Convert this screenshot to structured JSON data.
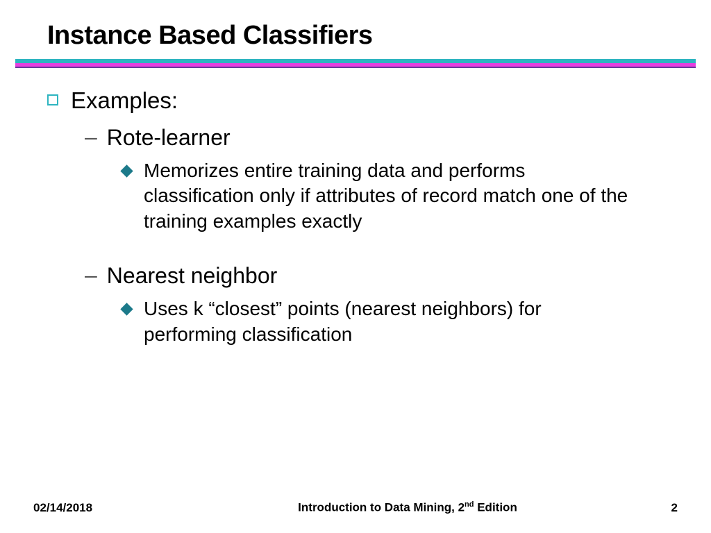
{
  "title": "Instance Based Classifiers",
  "examples_label": "Examples:",
  "items": [
    {
      "name": "Rote-learner",
      "desc": "Memorizes entire training data and performs classification only if attributes of record match one of the training examples exactly"
    },
    {
      "name": "Nearest neighbor",
      "desc": "Uses k “closest” points (nearest neighbors) for performing classification"
    }
  ],
  "footer": {
    "date": "02/14/2018",
    "book_prefix": "Introduction to Data Mining, 2",
    "book_sup": "nd",
    "book_suffix": " Edition",
    "page": "2"
  }
}
